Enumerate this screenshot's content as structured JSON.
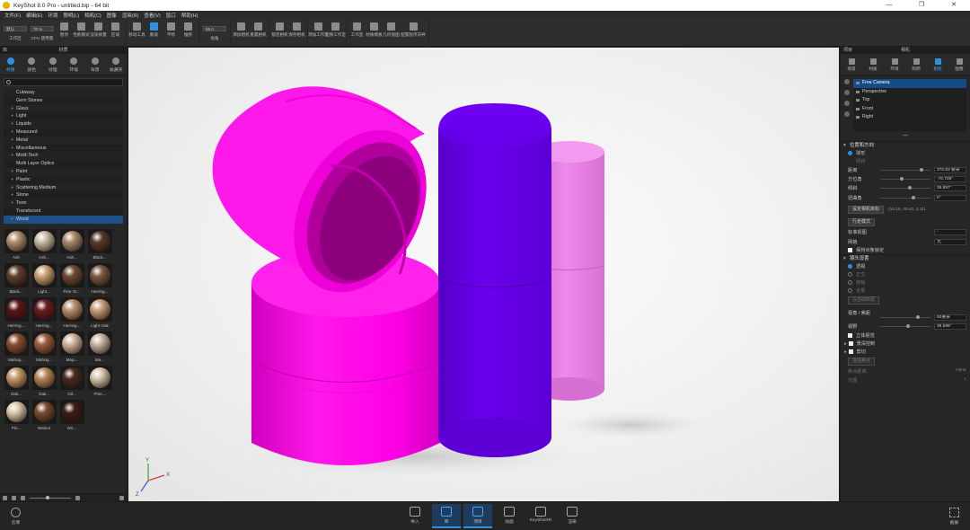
{
  "window": {
    "title": "KeyShot 8.0 Pro - untitled.bip - 64 bit",
    "controls": [
      "—",
      "❐",
      "✕"
    ]
  },
  "menu": [
    "文件(F)",
    "编辑(E)",
    "环境",
    "照明(L)",
    "相机(C)",
    "图像",
    "渲染(R)",
    "查看(V)",
    "窗口",
    "帮助(H)"
  ],
  "toolbar": {
    "workspace_value": "默认",
    "cpu_value": "70 %",
    "zoom_value": "65.0",
    "groups": [
      [
        "工作区",
        "CPU 使用量",
        "暂停",
        "性能模式",
        "渲染质量",
        "区域"
      ],
      [
        "移动工具",
        "翻滚",
        "平移",
        "推移"
      ],
      [
        "视角"
      ],
      [
        "添加相机",
        "重置相机"
      ],
      [
        "锁定相机",
        "保存相机"
      ],
      [
        "添加工作室",
        "切换工作室"
      ],
      [
        "工作室",
        "材质模板",
        "几何视图",
        "配置程序向导"
      ]
    ]
  },
  "library": {
    "panel_title": "库",
    "section_title": "材质",
    "tabs": [
      "材质",
      "颜色",
      "纹理",
      "环境",
      "背景",
      "收藏夹"
    ],
    "active_tab": 0,
    "categories": [
      {
        "label": "Cutaway",
        "expandable": false
      },
      {
        "label": "Gem Stones",
        "expandable": false
      },
      {
        "label": "Glass",
        "expandable": true
      },
      {
        "label": "Light",
        "expandable": true
      },
      {
        "label": "Liquids",
        "expandable": true
      },
      {
        "label": "Measured",
        "expandable": true
      },
      {
        "label": "Metal",
        "expandable": true
      },
      {
        "label": "Miscellaneous",
        "expandable": true
      },
      {
        "label": "Mold-Tech",
        "expandable": true
      },
      {
        "label": "Multi Layer Optics",
        "expandable": false
      },
      {
        "label": "Paint",
        "expandable": true
      },
      {
        "label": "Plastic",
        "expandable": true
      },
      {
        "label": "Scattering Medium",
        "expandable": true
      },
      {
        "label": "Stone",
        "expandable": true
      },
      {
        "label": "Toon",
        "expandable": true
      },
      {
        "label": "Translucent",
        "expandable": false
      },
      {
        "label": "Wood",
        "expandable": true
      }
    ],
    "selected_category": "Wood",
    "materials": [
      {
        "label": "Ash",
        "color": "#b09070"
      },
      {
        "label": "Ash...",
        "color": "#c8bca8"
      },
      {
        "label": "Ash...",
        "color": "#a88a6a"
      },
      {
        "label": "Black...",
        "color": "#5a3a2a"
      },
      {
        "label": "Black...",
        "color": "#5e4030"
      },
      {
        "label": "Light...",
        "color": "#caa278"
      },
      {
        "label": "Fine Gr...",
        "color": "#6e4a36"
      },
      {
        "label": "Herring...",
        "color": "#7a5a44"
      },
      {
        "label": "Herring...",
        "color": "#5a1616"
      },
      {
        "label": "Herring...",
        "color": "#6a1c1c"
      },
      {
        "label": "Herring...",
        "color": "#b89070"
      },
      {
        "label": "Light Oak",
        "color": "#c6a07a"
      },
      {
        "label": "Mahog...",
        "color": "#8a4e32"
      },
      {
        "label": "Mahog...",
        "color": "#9a5c40"
      },
      {
        "label": "Map...",
        "color": "#d2b49a"
      },
      {
        "label": "Ma...",
        "color": "#c8b6a4"
      },
      {
        "label": "Oak...",
        "color": "#c69a6a"
      },
      {
        "label": "Oak...",
        "color": "#b8885a"
      },
      {
        "label": "Oil...",
        "color": "#4a2a1e"
      },
      {
        "label": "Pine...",
        "color": "#d8c6b0"
      },
      {
        "label": "Pin...",
        "color": "#dcc8ac"
      },
      {
        "label": "Walnut",
        "color": "#7a4a30"
      },
      {
        "label": "Wo...",
        "color": "#3c1e16"
      }
    ]
  },
  "project": {
    "panel_title": "项目",
    "section_title": "相机",
    "tabs": [
      "场景",
      "材质",
      "环境",
      "照明",
      "相机",
      "图像"
    ],
    "active_tab": 4,
    "cameras": [
      "Free Camera",
      "Perspective",
      "Top",
      "Front",
      "Right"
    ],
    "selected_camera": "Free Camera",
    "position_section": "位置和方向",
    "modes": [
      "球形",
      "倾斜"
    ],
    "active_mode": 0,
    "props": [
      {
        "label": "距离",
        "value": "370.63 要米",
        "knob_pct": 0.78
      },
      {
        "label": "方位角",
        "value": "-76.728°",
        "knob_pct": 0.4
      },
      {
        "label": "倾斜",
        "value": "36.897°",
        "knob_pct": 0.55
      },
      {
        "label": "扭曲角",
        "value": "0°",
        "knob_pct": 0.62
      }
    ],
    "look_at_button": "设定相机目标",
    "look_at_coords": "(16.18, 49.41, 4.11)",
    "walk_button": "行走模式",
    "standard_view_label": "标准视图",
    "standard_view_value": "-",
    "lock_label": "网格",
    "lock_value": "无",
    "protect_checkbox": "保持对象锁定",
    "lens_section": "镜头设置",
    "lens_modes": [
      "透视",
      "正交",
      "移轴",
      "全景"
    ],
    "active_lens": 0,
    "auto_button": "以自动匹配",
    "fov_label": "视角 / 焦距",
    "fov_value": "50要米",
    "fov_knob": 0.72,
    "angle_label": "视野",
    "angle_value": "39.598°",
    "angle_knob": 0.52,
    "stereo_checkbox": "立体视觉",
    "dof_section": "景深控制",
    "clip_section": "剪切",
    "focus_button": "选择焦点",
    "focus_distance_label": "焦点距离",
    "focus_distance_value": "0要米",
    "fstop_label": "光圈",
    "fstop_value": "1"
  },
  "bottom": {
    "left_label": "云库",
    "buttons": [
      {
        "label": "导入",
        "active": false
      },
      {
        "label": "库",
        "active": true
      },
      {
        "label": "项目",
        "active": true
      },
      {
        "label": "动画",
        "active": false
      },
      {
        "label": "KeyShotXR",
        "active": false
      },
      {
        "label": "渲染",
        "active": false
      }
    ],
    "right_label": "截屏"
  },
  "scene": {
    "background": "#f3f3f3",
    "colors": {
      "magenta": "#ff00e6",
      "violet": "#6a00ee",
      "pink": "#ea7ee6"
    },
    "axis_labels": [
      "X",
      "Y",
      "Z"
    ]
  }
}
